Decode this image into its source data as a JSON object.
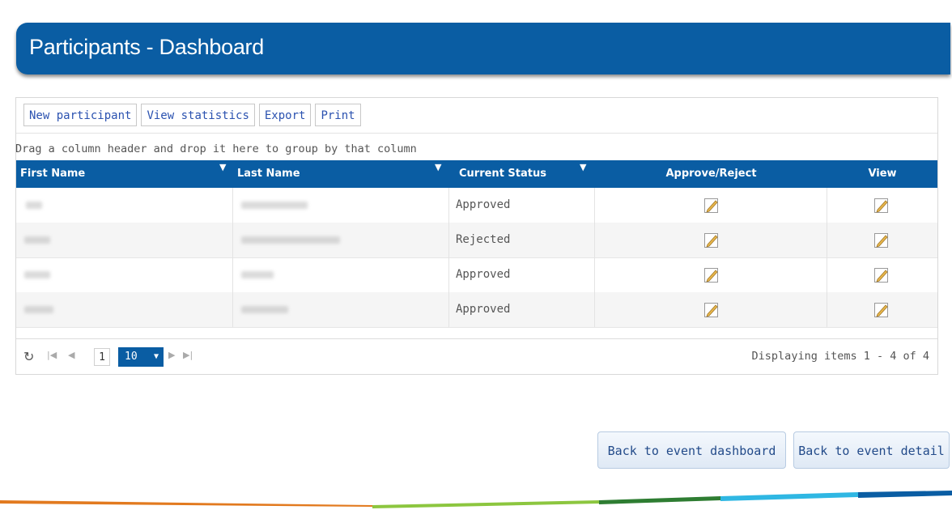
{
  "page": {
    "title": "Participants - Dashboard"
  },
  "toolbar": {
    "new_participant": "New participant",
    "view_statistics": "View statistics",
    "export": "Export",
    "print": "Print"
  },
  "grid": {
    "group_hint": "Drag a column header and drop it here to group by that column",
    "columns": {
      "first_name": "First Name",
      "last_name": "Last Name",
      "current_status": "Current Status",
      "approve_reject": "Approve/Reject",
      "view": "View"
    },
    "rows": [
      {
        "status": "Approved"
      },
      {
        "status": "Rejected"
      },
      {
        "status": "Approved"
      },
      {
        "status": "Approved"
      }
    ]
  },
  "pager": {
    "current_page": "1",
    "page_size": "10",
    "info": "Displaying items 1 - 4 of 4"
  },
  "actions": {
    "back_event_dashboard": "Back to event dashboard",
    "back_event_detail": "Back to event detail"
  },
  "colors": {
    "brand": "#0a5da3",
    "link": "#2b52b0"
  },
  "icons": [
    "refresh-icon",
    "first-page-icon",
    "prev-page-icon",
    "next-page-icon",
    "last-page-icon",
    "filter-icon",
    "edit-icon"
  ]
}
